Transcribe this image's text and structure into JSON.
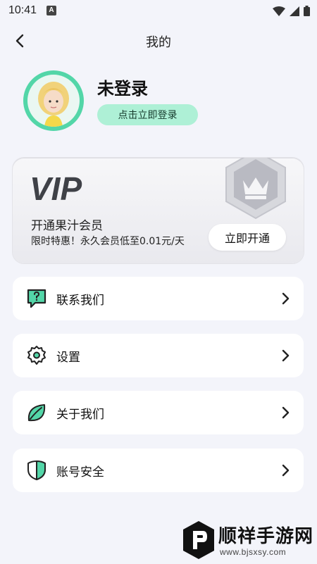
{
  "status_bar": {
    "time": "10:41",
    "notification_badge": "A"
  },
  "header": {
    "title": "我的"
  },
  "profile": {
    "name": "未登录",
    "login_button": "点击立即登录"
  },
  "vip": {
    "logo_text": "VIP",
    "title": "开通果汁会员",
    "subtitle": "限时特惠！永久会员低至0.01元/天",
    "open_button": "立即开通"
  },
  "menu": {
    "items": [
      {
        "label": "联系我们",
        "icon": "chat-question-icon"
      },
      {
        "label": "设置",
        "icon": "gear-icon"
      },
      {
        "label": "关于我们",
        "icon": "leaf-icon"
      },
      {
        "label": "账号安全",
        "icon": "shield-icon"
      }
    ]
  },
  "watermark": {
    "brand": "顺祥手游网",
    "url": "www.bjsxsy.com"
  },
  "colors": {
    "accent": "#53d6a8",
    "login_button_bg": "#aef0d6",
    "background": "#f3f4fa"
  }
}
